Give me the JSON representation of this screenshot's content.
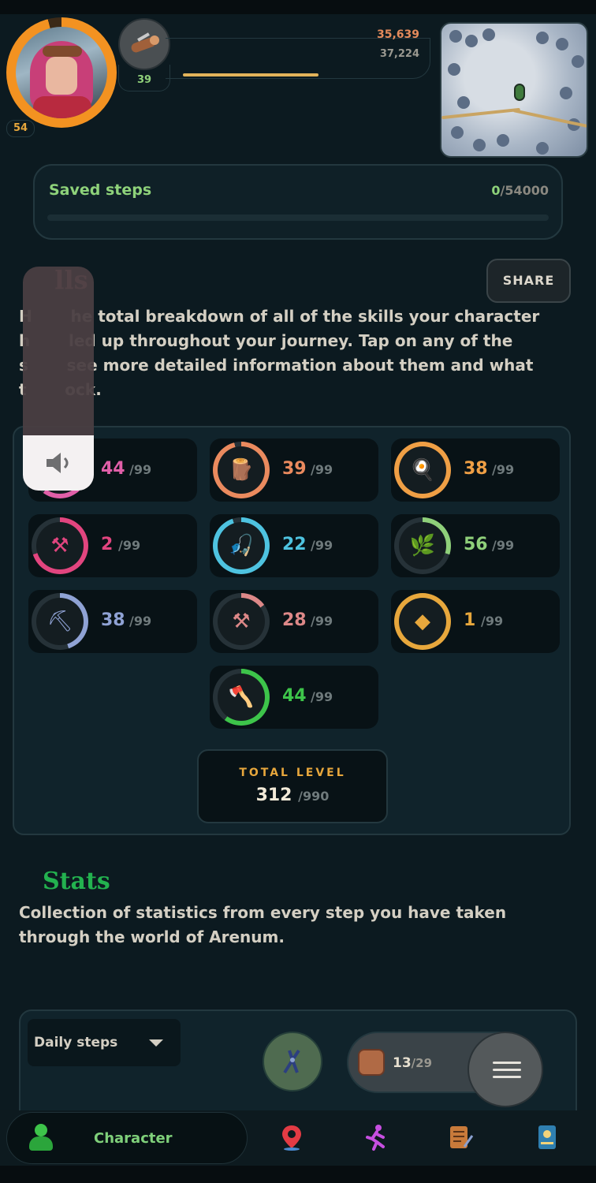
{
  "header": {
    "player_level": "54",
    "current_skill_level": "39",
    "xp_current": "35,639",
    "xp_next": "37,224",
    "current_skill_icon": "log-icon",
    "avatar_ring_color": "#f39221"
  },
  "saved_steps": {
    "label": "Saved steps",
    "current": "0",
    "max": "/54000"
  },
  "skills_section": {
    "title": "Skills",
    "visible_title": "lls",
    "share_label": "SHARE",
    "description": "Here is the total breakdown of all of the skills your character has leveled up throughout your journey. Tap on any of the skills to see more detailed information about them and what they unlock.",
    "description_visible_lines": [
      "H       he total breakdown of all of the skills your character",
      "h       led up throughout your journey. Tap on any of the",
      "s       see more detailed information about them and what",
      "t       ock."
    ],
    "skills": [
      {
        "level": "44",
        "max": "/99",
        "color": "#e05fa8",
        "icon": "heart-icon",
        "progress": 0.6
      },
      {
        "level": "39",
        "max": "/99",
        "color": "#ea8a5e",
        "icon": "log-icon",
        "progress": 0.96
      },
      {
        "level": "38",
        "max": "/99",
        "color": "#ef9f45",
        "icon": "frying-pan-icon",
        "progress": 1.0
      },
      {
        "level": "2",
        "max": "/99",
        "color": "#e2457f",
        "icon": "hammer-icon",
        "progress": 0.7
      },
      {
        "level": "22",
        "max": "/99",
        "color": "#4ec3e0",
        "icon": "fishing-rod-icon",
        "progress": 0.95
      },
      {
        "level": "56",
        "max": "/99",
        "color": "#8fd07a",
        "icon": "herb-icon",
        "progress": 0.3
      },
      {
        "level": "38",
        "max": "/99",
        "color": "#8fa2d4",
        "icon": "pickaxe-icon",
        "progress": 0.45
      },
      {
        "level": "28",
        "max": "/99",
        "color": "#dd8888",
        "icon": "anvil-icon",
        "progress": 0.15
      },
      {
        "level": "1",
        "max": "/99",
        "color": "#e7a73c",
        "icon": "gem-icon",
        "progress": 1.0
      },
      {
        "level": "44",
        "max": "/99",
        "color": "#3dc44a",
        "icon": "axe-icon",
        "progress": 0.6
      }
    ],
    "total_level_label": "TOTAL LEVEL",
    "total_level": "312",
    "total_level_max": "/990"
  },
  "stats_section": {
    "title": "Stats",
    "description_lines": [
      "Collection of statistics from every step you have taken",
      "through the world of Arenum."
    ],
    "dropdown_value": "Daily steps"
  },
  "floating": {
    "bag_count": "13",
    "bag_max": "/29"
  },
  "volume": {
    "level": 0.25
  },
  "bottom_nav": {
    "active_label": "Character",
    "items": [
      "character-icon",
      "map-pin-icon",
      "running-icon",
      "quest-scroll-icon",
      "journal-icon"
    ]
  }
}
